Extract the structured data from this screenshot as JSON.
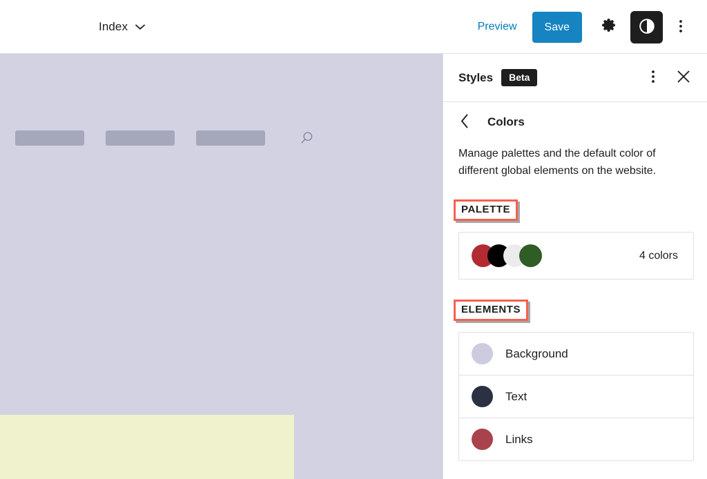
{
  "topbar": {
    "document_label": "Index",
    "chevron_icon": "chevron-down-icon",
    "preview_label": "Preview",
    "save_label": "Save",
    "settings_icon": "gear-icon",
    "contrast_icon": "contrast-icon",
    "more_icon": "kebab-menu-icon",
    "save_bg": "#1584c0",
    "preview_color": "#007cba"
  },
  "canvas": {
    "background": "#d2d2e3",
    "nav_placeholders": [
      "",
      "",
      ""
    ],
    "search_icon": "search-icon",
    "block_color": "#eff2cc"
  },
  "sidebar": {
    "title": "Styles",
    "badge": "Beta",
    "more_icon": "kebab-menu-icon",
    "close_icon": "close-icon",
    "back_icon": "chevron-left-icon",
    "screen_title": "Colors",
    "description": "Manage palettes and the default color of different global elements on the website.",
    "annotation_color": "#f4614f",
    "palette": {
      "heading": "PALETTE",
      "count_label": "4 colors",
      "swatches": [
        {
          "name": "red",
          "hex": "#b32b32"
        },
        {
          "name": "black",
          "hex": "#000000"
        },
        {
          "name": "white",
          "hex": "#ececec"
        },
        {
          "name": "green",
          "hex": "#2f5d25"
        }
      ]
    },
    "elements": {
      "heading": "ELEMENTS",
      "items": [
        {
          "label": "Background",
          "hex": "#cdcbe0"
        },
        {
          "label": "Text",
          "hex": "#2b3142"
        },
        {
          "label": "Links",
          "hex": "#a8434b"
        }
      ]
    }
  }
}
